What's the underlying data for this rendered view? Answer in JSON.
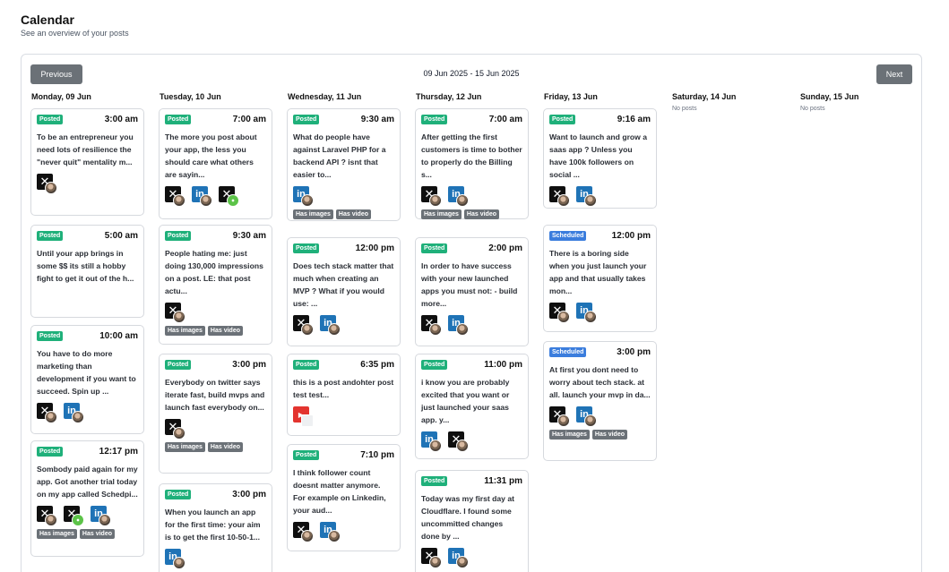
{
  "header": {
    "title": "Calendar",
    "subtitle": "See an overview of your posts"
  },
  "nav": {
    "previous_label": "Previous",
    "next_label": "Next",
    "range_label": "09 Jun 2025 - 15 Jun 2025"
  },
  "days": [
    {
      "label": "Monday, 09 Jun",
      "posts": [
        {
          "status": "Posted",
          "time": "3:00 am",
          "text": "To be an entrepreneur you need lots of resilience the \"never quit\" mentality m...",
          "networks": [
            "x-icon"
          ],
          "tags": []
        },
        {
          "status": "Posted",
          "time": "5:00 am",
          "text": "Until your app brings in some $$ its still a hobby fight to get it out of the h...",
          "networks": [],
          "tags": []
        },
        {
          "status": "Posted",
          "time": "10:00 am",
          "text": "You have to do more marketing than development if you want to succeed. Spin up ...",
          "networks": [
            "x-icon",
            "linkedin-icon"
          ],
          "tags": []
        },
        {
          "status": "Posted",
          "time": "12:17 pm",
          "text": "Sombody paid again for my app. Got another trial today on my app called Schedpi...",
          "networks": [
            "x-icon",
            "x-icon",
            "linkedin-icon"
          ],
          "tags": [
            "Has images",
            "Has video"
          ]
        }
      ]
    },
    {
      "label": "Tuesday, 10 Jun",
      "posts": [
        {
          "status": "Posted",
          "time": "7:00 am",
          "text": "The more you post about your app, the less you should care what others are sayin...",
          "networks": [
            "x-icon",
            "linkedin-icon",
            "x-icon"
          ],
          "tags": []
        },
        {
          "status": "Posted",
          "time": "9:30 am",
          "text": "People hating me: just doing 130,000 impressions on a post. LE: that post actu...",
          "networks": [
            "x-icon"
          ],
          "tags": [
            "Has images",
            "Has video"
          ]
        },
        {
          "status": "Posted",
          "time": "3:00 pm",
          "text": "Everybody on twitter says iterate fast, build mvps and launch fast everybody on...",
          "networks": [
            "x-icon"
          ],
          "tags": [
            "Has images",
            "Has video"
          ]
        },
        {
          "status": "Posted",
          "time": "3:00 pm",
          "text": "When you launch an app for the first time: your aim is to get the first 10-50-1...",
          "networks": [
            "linkedin-icon"
          ],
          "tags": []
        }
      ]
    },
    {
      "label": "Wednesday, 11 Jun",
      "posts": [
        {
          "status": "Posted",
          "time": "9:30 am",
          "text": "What do people have against Laravel PHP for a backend API ? isnt that easier to...",
          "networks": [
            "linkedin-icon"
          ],
          "tags": [
            "Has images",
            "Has video"
          ]
        },
        {
          "status": "Posted",
          "time": "12:00 pm",
          "text": "Does tech stack matter that much when creating an MVP ? What if you would use: ...",
          "networks": [
            "x-icon",
            "linkedin-icon"
          ],
          "tags": []
        },
        {
          "status": "Posted",
          "time": "6:35 pm",
          "text": "this is a post andohter post test test...",
          "networks": [
            "youtube-icon"
          ],
          "tags": []
        },
        {
          "status": "Posted",
          "time": "7:10 pm",
          "text": "I think follower count doesnt matter anymore. For example on Linkedin, your aud...",
          "networks": [
            "x-icon",
            "linkedin-icon"
          ],
          "tags": []
        }
      ]
    },
    {
      "label": "Thursday, 12 Jun",
      "posts": [
        {
          "status": "Posted",
          "time": "7:00 am",
          "text": "After getting the first customers is time to bother to properly do the Billing s...",
          "networks": [
            "x-icon",
            "linkedin-icon"
          ],
          "tags": [
            "Has images",
            "Has video"
          ]
        },
        {
          "status": "Posted",
          "time": "2:00 pm",
          "text": "In order to have success with your new launched apps you must not: - build more...",
          "networks": [
            "x-icon",
            "linkedin-icon"
          ],
          "tags": []
        },
        {
          "status": "Posted",
          "time": "11:00 pm",
          "text": "i know you are probably excited that you want or just launched your saas app. y...",
          "networks": [
            "linkedin-icon",
            "x-icon"
          ],
          "tags": []
        },
        {
          "status": "Posted",
          "time": "11:31 pm",
          "text": "Today was my first day at Cloudflare. I found some uncommitted changes done by ...",
          "networks": [
            "x-icon",
            "linkedin-icon"
          ],
          "tags": []
        }
      ]
    },
    {
      "label": "Friday, 13 Jun",
      "posts": [
        {
          "status": "Posted",
          "time": "9:16 am",
          "text": "Want to launch and grow a saas app ? Unless you have 100k followers on social ...",
          "networks": [
            "x-icon",
            "linkedin-icon"
          ],
          "tags": []
        },
        {
          "status": "Scheduled",
          "time": "12:00 pm",
          "text": "There is a boring side when you just launch your app and that usually takes mon...",
          "networks": [
            "x-icon",
            "linkedin-icon"
          ],
          "tags": []
        },
        {
          "status": "Scheduled",
          "time": "3:00 pm",
          "text": "At first you dont need to worry about tech stack. at all. launch your mvp in da...",
          "networks": [
            "x-icon",
            "linkedin-icon"
          ],
          "tags": [
            "Has images",
            "Has video"
          ]
        }
      ]
    },
    {
      "label": "Saturday, 14 Jun",
      "empty_label": "No posts",
      "posts": []
    },
    {
      "label": "Sunday, 15 Jun",
      "empty_label": "No posts",
      "posts": []
    }
  ]
}
